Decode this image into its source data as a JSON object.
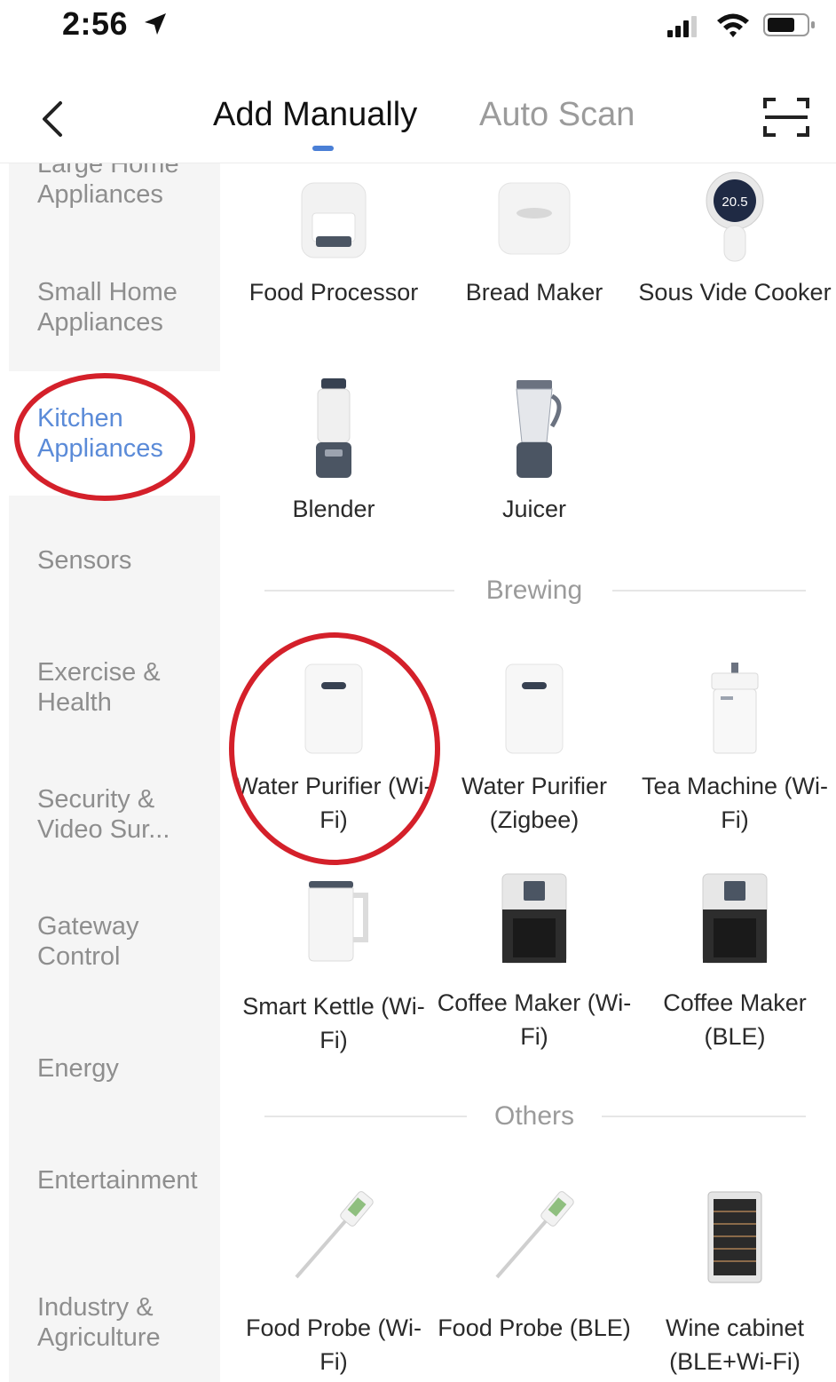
{
  "status_bar": {
    "time": "2:56"
  },
  "navbar": {
    "tabs": [
      {
        "label": "Add Manually",
        "active": true
      },
      {
        "label": "Auto Scan",
        "active": false
      }
    ],
    "indicator_color": "#4a7fd6"
  },
  "sidebar": {
    "items": [
      {
        "label": "Large Home Appliances"
      },
      {
        "label": "Small Home Appliances"
      },
      {
        "label": "Kitchen Appliances",
        "active": true
      },
      {
        "label": "Sensors"
      },
      {
        "label": "Exercise & Health"
      },
      {
        "label": "Security & Video Sur..."
      },
      {
        "label": "Gateway Control"
      },
      {
        "label": "Energy"
      },
      {
        "label": "Entertainment"
      },
      {
        "label": "Industry & Agriculture"
      }
    ],
    "active_color": "#5b8bd8"
  },
  "main": {
    "items": [
      {
        "label": "Food Processor",
        "icon": "food-processor-icon"
      },
      {
        "label": "Bread Maker",
        "icon": "bread-maker-icon"
      },
      {
        "label": "Sous Vide Cooker",
        "icon": "sous-vide-icon",
        "display": "20.5"
      },
      {
        "label": "Blender",
        "icon": "blender-icon"
      },
      {
        "label": "Juicer",
        "icon": "juicer-icon"
      }
    ],
    "sections": [
      {
        "title": "Brewing",
        "items": [
          {
            "label": "Water Purifier (Wi-Fi)",
            "icon": "water-purifier-icon"
          },
          {
            "label": "Water Purifier (Zigbee)",
            "icon": "water-purifier-icon"
          },
          {
            "label": "Tea Machine (Wi-Fi)",
            "icon": "tea-machine-icon"
          },
          {
            "label": "Smart Kettle (Wi-Fi)",
            "icon": "kettle-icon"
          },
          {
            "label": "Coffee Maker (Wi-Fi)",
            "icon": "coffee-maker-icon"
          },
          {
            "label": "Coffee Maker (BLE)",
            "icon": "coffee-maker-icon"
          }
        ]
      },
      {
        "title": "Others",
        "items": [
          {
            "label": "Food Probe (Wi-Fi)",
            "icon": "food-probe-icon"
          },
          {
            "label": "Food Probe (BLE)",
            "icon": "food-probe-icon"
          },
          {
            "label": "Wine cabinet (BLE+Wi-Fi)",
            "icon": "wine-cabinet-icon"
          }
        ]
      }
    ]
  },
  "annotation_color": "#d4202a"
}
